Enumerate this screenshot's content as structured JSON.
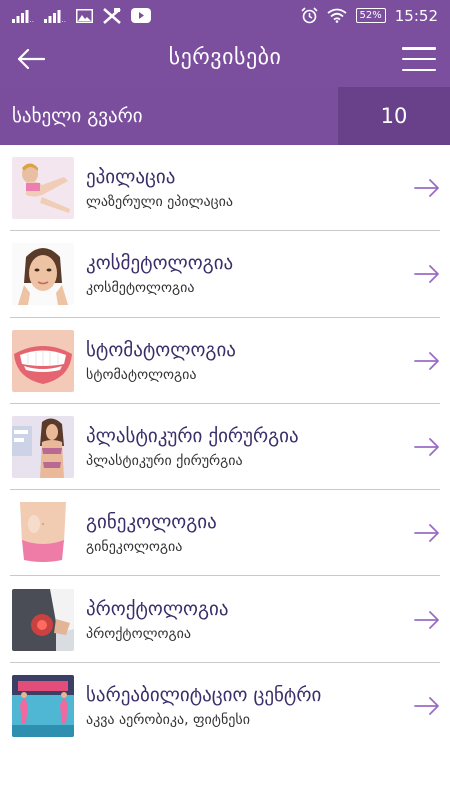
{
  "status_bar": {
    "battery": "52%",
    "time": "15:52"
  },
  "header": {
    "title": "სერვისები",
    "back_icon": "arrow-left-icon",
    "menu_icon": "hamburger-menu-icon"
  },
  "user_bar": {
    "name": "სახელი გვარი",
    "count": "10"
  },
  "colors": {
    "primary": "#7b4e9e",
    "primary_dark": "#68418a",
    "title_text": "#3a2e6a",
    "arrow": "#9b6cc7"
  },
  "services": [
    {
      "title": "ეპილაცია",
      "subtitle": "ლაზერული ეპილაცია"
    },
    {
      "title": "კოსმეტოლოგია",
      "subtitle": "კოსმეტოლოგია"
    },
    {
      "title": "სტომატოლოგია",
      "subtitle": "სტომატოლოგია"
    },
    {
      "title": "პლასტიკური ქირურგია",
      "subtitle": "პლასტიკური ქირურგია"
    },
    {
      "title": "გინეკოლოგია",
      "subtitle": "გინეკოლოგია"
    },
    {
      "title": "პროქტოლოგია",
      "subtitle": "პროქტოლოგია"
    },
    {
      "title": "სარეაბილიტაციო ცენტრი",
      "subtitle": "აკვა აერობიკა, ფიტნესი"
    }
  ]
}
